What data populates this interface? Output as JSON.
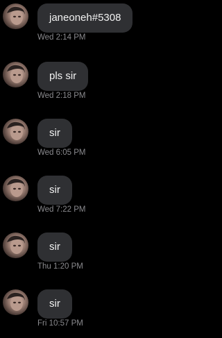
{
  "messages": [
    {
      "text": "janeoneh#5308",
      "time": "Wed 2:14 PM"
    },
    {
      "text": "pls sir",
      "time": "Wed 2:18 PM"
    },
    {
      "text": "sir",
      "time": "Wed 6:05 PM"
    },
    {
      "text": "sir",
      "time": "Wed 7:22 PM"
    },
    {
      "text": "sir",
      "time": "Thu 1:20 PM"
    },
    {
      "text": "sir",
      "time": "Fri 10:57 PM"
    }
  ],
  "colors": {
    "background": "#000000",
    "bubble": "#2f3033",
    "bubble_text": "#f2f2f2",
    "timestamp": "#8a8a8e"
  },
  "icons": {
    "avatar": "profile-photo-avatar"
  }
}
